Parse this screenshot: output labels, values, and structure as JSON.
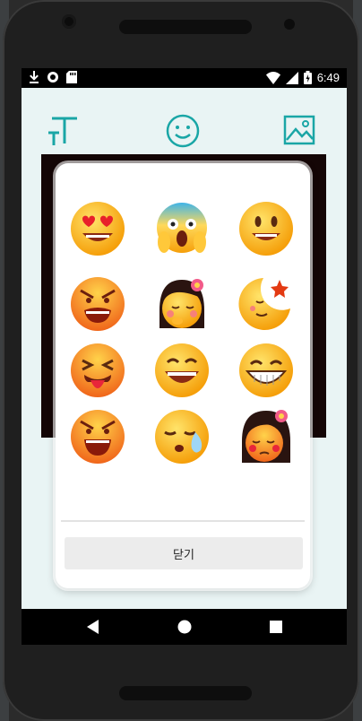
{
  "status_bar": {
    "time": "6:49",
    "left_icons": [
      "download-icon",
      "circle-status-icon",
      "sd-card-icon"
    ],
    "right_icons": [
      "wifi-icon",
      "signal-icon",
      "battery-icon"
    ]
  },
  "toolbar": {
    "icons": [
      "text-tool-icon",
      "emoji-tool-icon",
      "image-tool-icon"
    ],
    "accent_color": "#1aa6a6"
  },
  "emoji_dialog": {
    "emojis": [
      "heart-eyes-emoji",
      "screaming-emoji",
      "smiling-emoji",
      "angry-grin-emoji",
      "shy-girl-emoji",
      "moon-star-emoji",
      "tongue-squint-emoji",
      "laughing-emoji",
      "big-grin-emoji",
      "furious-emoji",
      "sleepy-emoji",
      "blushing-girl-emoji"
    ],
    "close_label": "닫기"
  },
  "nav_bar": {
    "icons": [
      "back-icon",
      "home-icon",
      "recents-icon"
    ]
  }
}
